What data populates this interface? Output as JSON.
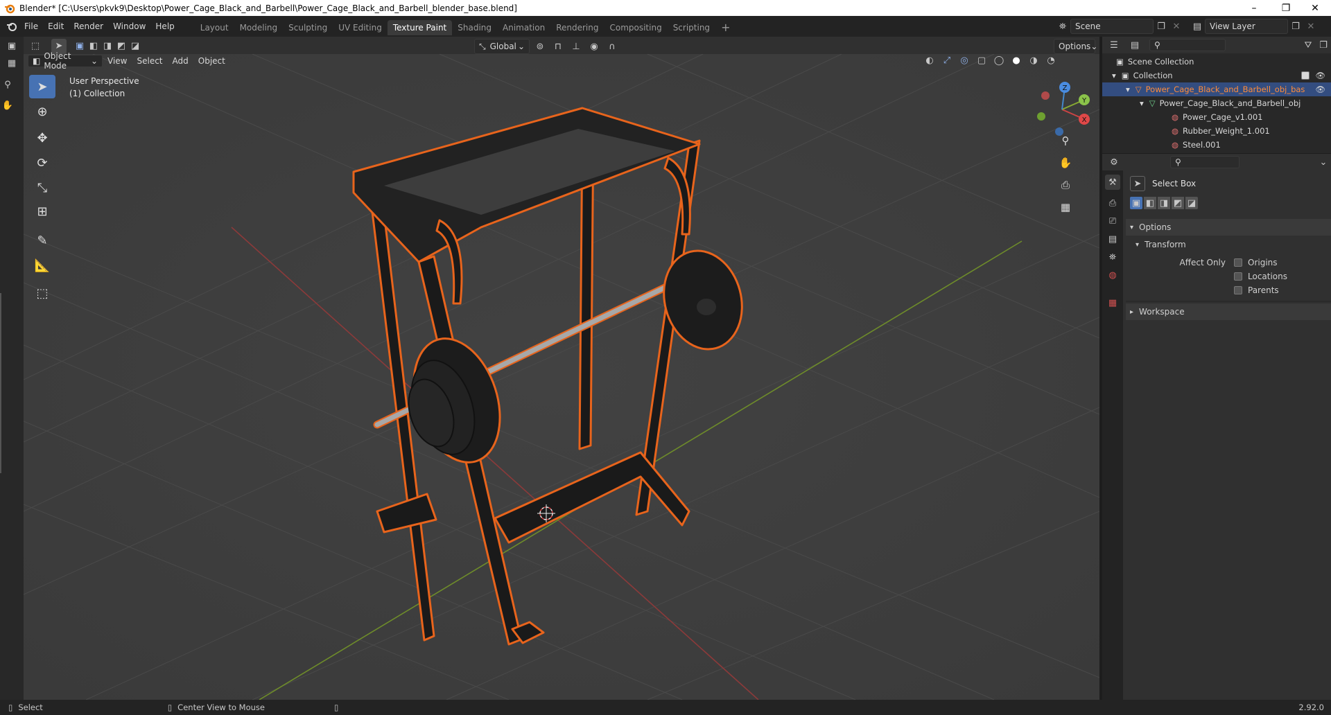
{
  "title_bar": {
    "text": "Blender* [C:\\Users\\pkvk9\\Desktop\\Power_Cage_Black_and_Barbell\\Power_Cage_Black_and_Barbell_blender_base.blend]",
    "minimize": "–",
    "maximize": "❐",
    "close": "✕"
  },
  "menu": [
    "File",
    "Edit",
    "Render",
    "Window",
    "Help"
  ],
  "workspaces": [
    "Layout",
    "Modeling",
    "Sculpting",
    "UV Editing",
    "Texture Paint",
    "Shading",
    "Animation",
    "Rendering",
    "Compositing",
    "Scripting"
  ],
  "active_workspace": "Texture Paint",
  "add_workspace": "+",
  "scene": {
    "label": "Scene",
    "view_layer": "View Layer"
  },
  "viewport_header": {
    "mode": "Object Mode",
    "menus": [
      "View",
      "Select",
      "Add",
      "Object"
    ],
    "orientation": "Global",
    "options": "Options"
  },
  "viewport": {
    "perspective": "User Perspective",
    "collection": "(1) Collection",
    "gizmo": {
      "x": "X",
      "y": "Y",
      "z": "Z"
    }
  },
  "outliner": {
    "rows": [
      {
        "label": "Scene Collection"
      },
      {
        "label": "Collection"
      },
      {
        "label": "Power_Cage_Black_and_Barbell_obj_bas"
      },
      {
        "label": "Power_Cage_Black_and_Barbell_obj"
      },
      {
        "label": "Power_Cage_v1.001"
      },
      {
        "label": "Rubber_Weight_1.001"
      },
      {
        "label": "Steel.001"
      }
    ]
  },
  "properties": {
    "tool_name": "Select Box",
    "options_label": "Options",
    "transform_label": "Transform",
    "affect_only_label": "Affect Only",
    "checkboxes": [
      "Origins",
      "Locations",
      "Parents"
    ],
    "workspace_label": "Workspace"
  },
  "status_bar": {
    "select": "Select",
    "center_view": "Center View to Mouse",
    "version": "2.92.0"
  },
  "colors": {
    "accent": "#4772b3",
    "selection_outline": "#e8641c",
    "object_highlight_text": "#ff8c3a",
    "grid_x_axis": "#9a3a3a",
    "grid_y_axis": "#6e8c2a"
  }
}
